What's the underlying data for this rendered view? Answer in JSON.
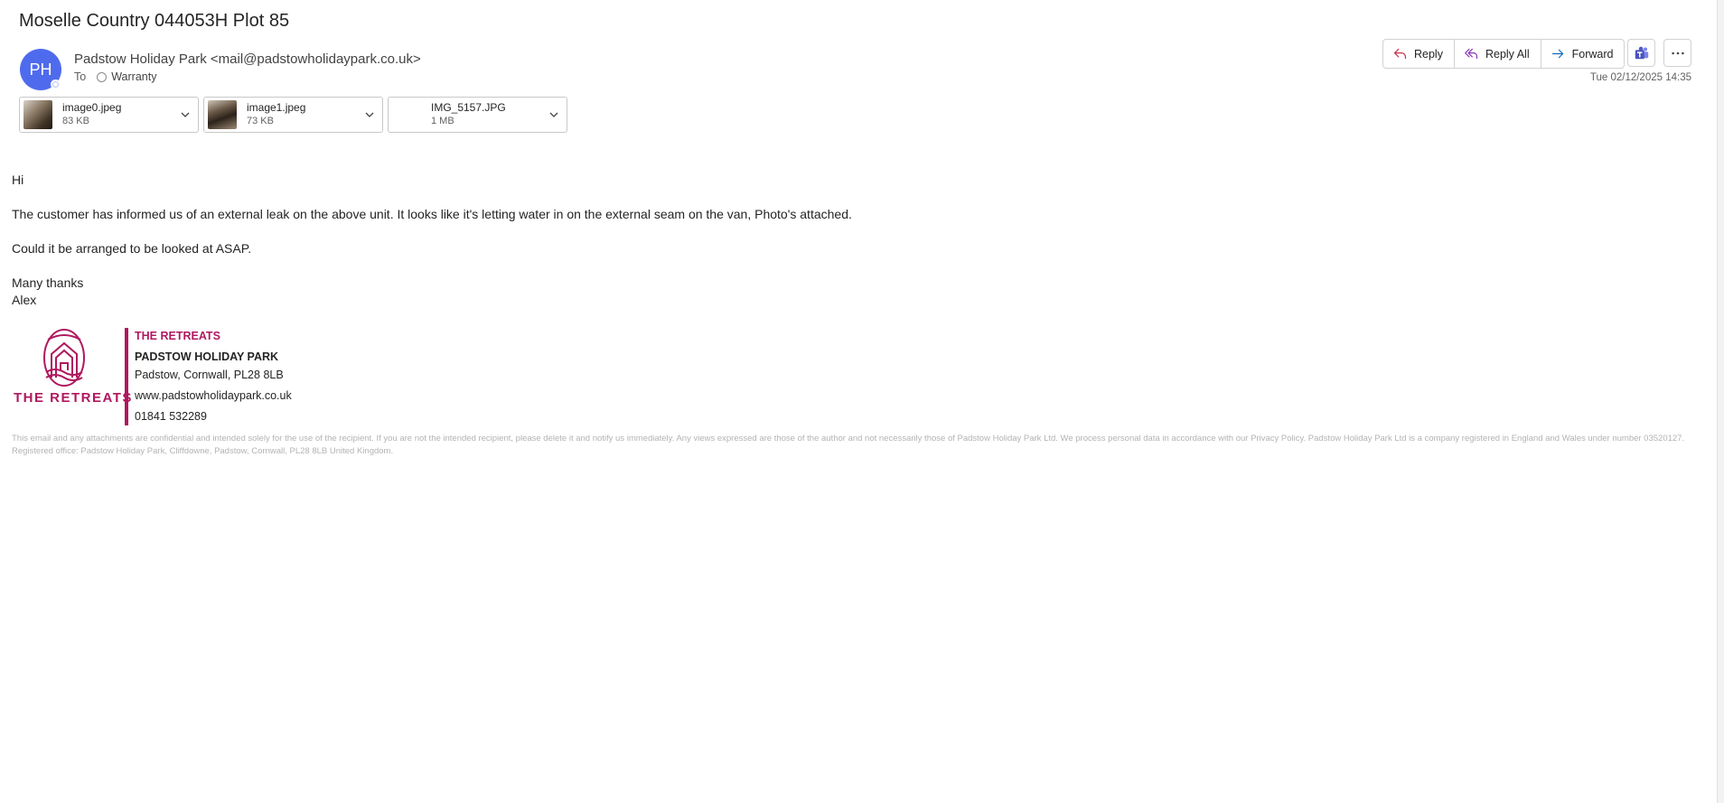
{
  "email": {
    "subject": "Moselle Country 044053H Plot 85",
    "avatar_initials": "PH",
    "sender": "Padstow Holiday Park <mail@padstowholidaypark.co.uk>",
    "to_label": "To",
    "recipient": "Warranty",
    "date": "Tue 02/12/2025 14:35"
  },
  "actions": {
    "reply": "Reply",
    "reply_all": "Reply All",
    "forward": "Forward"
  },
  "attachments": [
    {
      "name": "image0.jpeg",
      "size": "83 KB"
    },
    {
      "name": "image1.jpeg",
      "size": "73 KB"
    },
    {
      "name": "IMG_5157.JPG",
      "size": "1 MB"
    }
  ],
  "body": {
    "greeting": "Hi",
    "paragraph1": "The customer has informed us of an external leak on the above unit. It looks like it's letting water in on the external seam on the van, Photo's attached.",
    "paragraph2": "Could it be arranged to be looked at ASAP.",
    "closing": "Many thanks",
    "name": "Alex"
  },
  "signature": {
    "logo_text": "THE RETREATS",
    "brand": "THE RETREATS",
    "park_name": "PADSTOW HOLIDAY PARK",
    "address": "Padstow, Cornwall, PL28 8LB",
    "website": "www.padstowholidaypark.co.uk",
    "phone": "01841 532289",
    "brand_color": "#b0185f"
  },
  "disclaimer": "This email and any attachments are confidential and intended solely for the use of the recipient. If you are not the intended recipient, please delete it and notify us immediately. Any views expressed are those of the author and not necessarily those of Padstow Holiday Park Ltd. We process personal data in accordance with our Privacy Policy. Padstow Holiday Park Ltd is a company registered in England and Wales under number 03520127. Registered office: Padstow Holiday Park, Cliffdowne, Padstow, Cornwall, PL28 8LB United Kingdom.",
  "icons": {
    "reply": "reply-icon",
    "reply_all": "reply-all-icon",
    "forward": "forward-icon",
    "teams": "teams-icon",
    "more": "more-icon",
    "chevron": "chevron-down-icon"
  },
  "colors": {
    "avatar": "#4f6bed",
    "reply_icon": "#c4314b",
    "reply_all_icon": "#8a3ab9",
    "forward_icon": "#0f6cbd",
    "teams": "#4b53bc"
  }
}
